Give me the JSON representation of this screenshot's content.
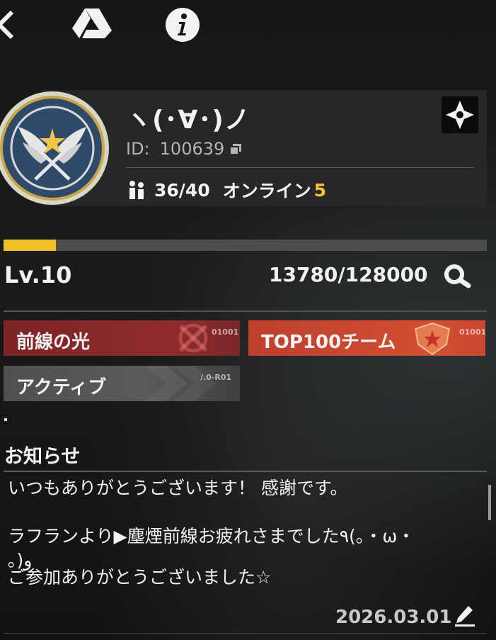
{
  "header": {
    "back_icon": "chevron-left-icon",
    "drive_icon": "triangle-drive-icon",
    "info_icon": "info-icon"
  },
  "team": {
    "name": "ヽ(･∀･)ノ",
    "id_label": "ID:",
    "id_value": "100639",
    "member_count": "36/40",
    "online_label": "オンライン",
    "online_count": "5"
  },
  "progress": {
    "level": "Lv.10",
    "xp_text": "13780/128000",
    "xp_fraction": 0.108
  },
  "tags": [
    {
      "label": "前線の光",
      "code": "01001",
      "color": "#8a2a2c"
    },
    {
      "label": "TOP100チーム",
      "code": "01001",
      "color": "#d04a30"
    },
    {
      "label": "アクティブ",
      "code": "/.0-R01",
      "color": "#575757"
    }
  ],
  "notice": {
    "title": "お知らせ",
    "lines": [
      "いつもありがとうございます！ 感謝です。",
      "ラフランより▶塵煙前線お疲れさまでした٩(｡・ω・",
      "｡)و",
      "ご参加ありがとうございました☆"
    ],
    "date": "2026.03.01"
  },
  "colors": {
    "accent": "#f2c027",
    "online": "#f3c43a",
    "panel": "#282828"
  }
}
